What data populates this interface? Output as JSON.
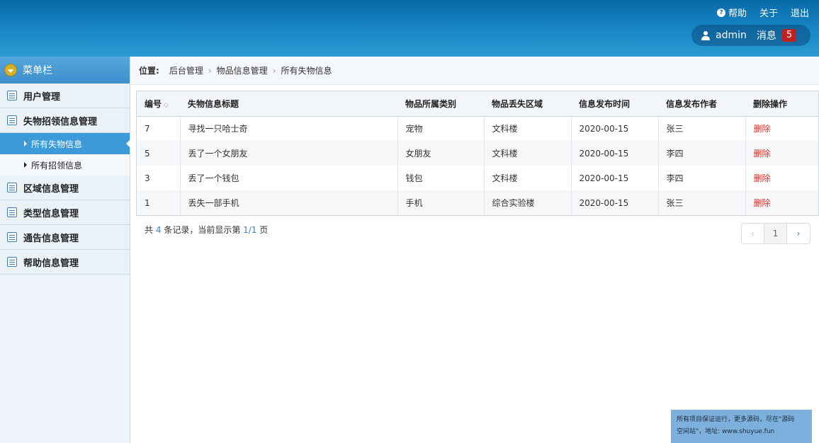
{
  "header": {
    "help_label": "帮助",
    "about_label": "关于",
    "logout_label": "退出",
    "username": "admin",
    "message_label": "消息",
    "message_count": "5"
  },
  "sidebar": {
    "title": "菜单栏",
    "groups": [
      {
        "label": "用户管理"
      },
      {
        "label": "失物招领信息管理",
        "items": [
          {
            "label": "所有失物信息",
            "active": true
          },
          {
            "label": "所有招领信息"
          }
        ]
      },
      {
        "label": "区域信息管理"
      },
      {
        "label": "类型信息管理"
      },
      {
        "label": "通告信息管理"
      },
      {
        "label": "帮助信息管理"
      }
    ]
  },
  "breadcrumb": {
    "label": "位置:",
    "items": [
      "后台管理",
      "物品信息管理",
      "所有失物信息"
    ]
  },
  "table": {
    "columns": [
      "编号",
      "失物信息标题",
      "物品所属类别",
      "物品丢失区域",
      "信息发布时间",
      "信息发布作者",
      "删除操作"
    ],
    "rows": [
      {
        "id": "7",
        "title": "寻找一只哈士奇",
        "category": "宠物",
        "area": "文科楼",
        "time": "2020-00-15",
        "author": "张三",
        "action": "删除"
      },
      {
        "id": "5",
        "title": "丢了一个女朋友",
        "category": "女朋友",
        "area": "文科楼",
        "time": "2020-00-15",
        "author": "李四",
        "action": "删除"
      },
      {
        "id": "3",
        "title": "丢了一个钱包",
        "category": "钱包",
        "area": "文科楼",
        "time": "2020-00-15",
        "author": "李四",
        "action": "删除"
      },
      {
        "id": "1",
        "title": "丢失一部手机",
        "category": "手机",
        "area": "综合实验楼",
        "time": "2020-00-15",
        "author": "张三",
        "action": "删除"
      }
    ]
  },
  "pagination": {
    "prefix": "共",
    "total": "4",
    "middle": "条记录，当前显示第",
    "page_info": "1/1",
    "suffix": "页",
    "current_page": "1",
    "prev_icon": "‹",
    "next_icon": "›"
  },
  "watermark": {
    "line1": "所有项目保证运行，更多源码，尽在\"源码",
    "line2": "空间站\"，地址: www.shuyue.fun"
  }
}
